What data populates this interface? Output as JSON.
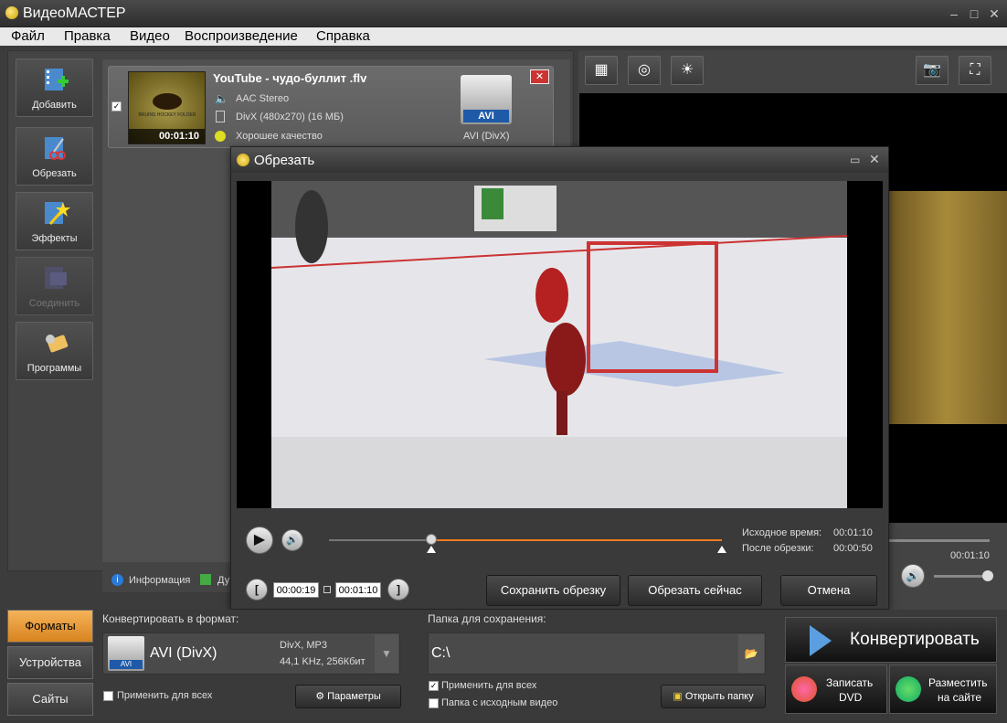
{
  "window": {
    "title": "ВидеоМАСТЕР"
  },
  "menu": [
    "Файл",
    "Правка",
    "Видео",
    "Воспроизведение",
    "Справка"
  ],
  "sidebar": {
    "items": [
      {
        "label": "Добавить"
      },
      {
        "label": "Обрезать"
      },
      {
        "label": "Эффекты"
      },
      {
        "label": "Соединить"
      },
      {
        "label": "Программы"
      }
    ]
  },
  "file": {
    "name": "YouTube - чудо-буллит .flv",
    "audio": "AAC Stereo",
    "video": "DivX (480x270) (16 МБ)",
    "quality": "Хорошее качество",
    "duration": "00:01:10",
    "format_badge": "AVI",
    "format_label": "AVI (DivX)",
    "thumb_caption": "BRUINS HOCKEY FOLDER"
  },
  "bottom_tabs": {
    "info": "Информация",
    "dup": "Ду"
  },
  "preview": {
    "time": "00:01:10"
  },
  "dialog": {
    "title": "Обрезать",
    "source_time_label": "Исходное время:",
    "source_time": "00:01:10",
    "after_label": "После обрезки:",
    "after_time": "00:00:50",
    "start_time": "00:00:19",
    "end_time": "00:01:10",
    "save_button": "Сохранить обрезку",
    "cut_now_button": "Обрезать сейчас",
    "cancel_button": "Отмена",
    "trim_start_fraction": 0.26,
    "trim_end_fraction": 1.0
  },
  "left_tabs": {
    "formats": "Форматы",
    "devices": "Устройства",
    "sites": "Сайты"
  },
  "format": {
    "header": "Конвертировать в формат:",
    "name": "AVI (DivX)",
    "badge": "AVI",
    "codec": "DivX, MP3",
    "params": "44,1 KHz, 256Кбит",
    "apply_all": "Применить для всех",
    "params_button": "Параметры"
  },
  "save": {
    "header": "Папка для сохранения:",
    "path": "C:\\",
    "apply_all": "Применить для всех",
    "source_folder": "Папка с исходным видео",
    "open_folder": "Открыть папку"
  },
  "actions": {
    "convert": "Конвертировать",
    "burn_line1": "Записать",
    "burn_line2": "DVD",
    "publish_line1": "Разместить",
    "publish_line2": "на сайте"
  },
  "colors": {
    "accent": "#f07a20",
    "tab_active": "#e89a3a"
  }
}
